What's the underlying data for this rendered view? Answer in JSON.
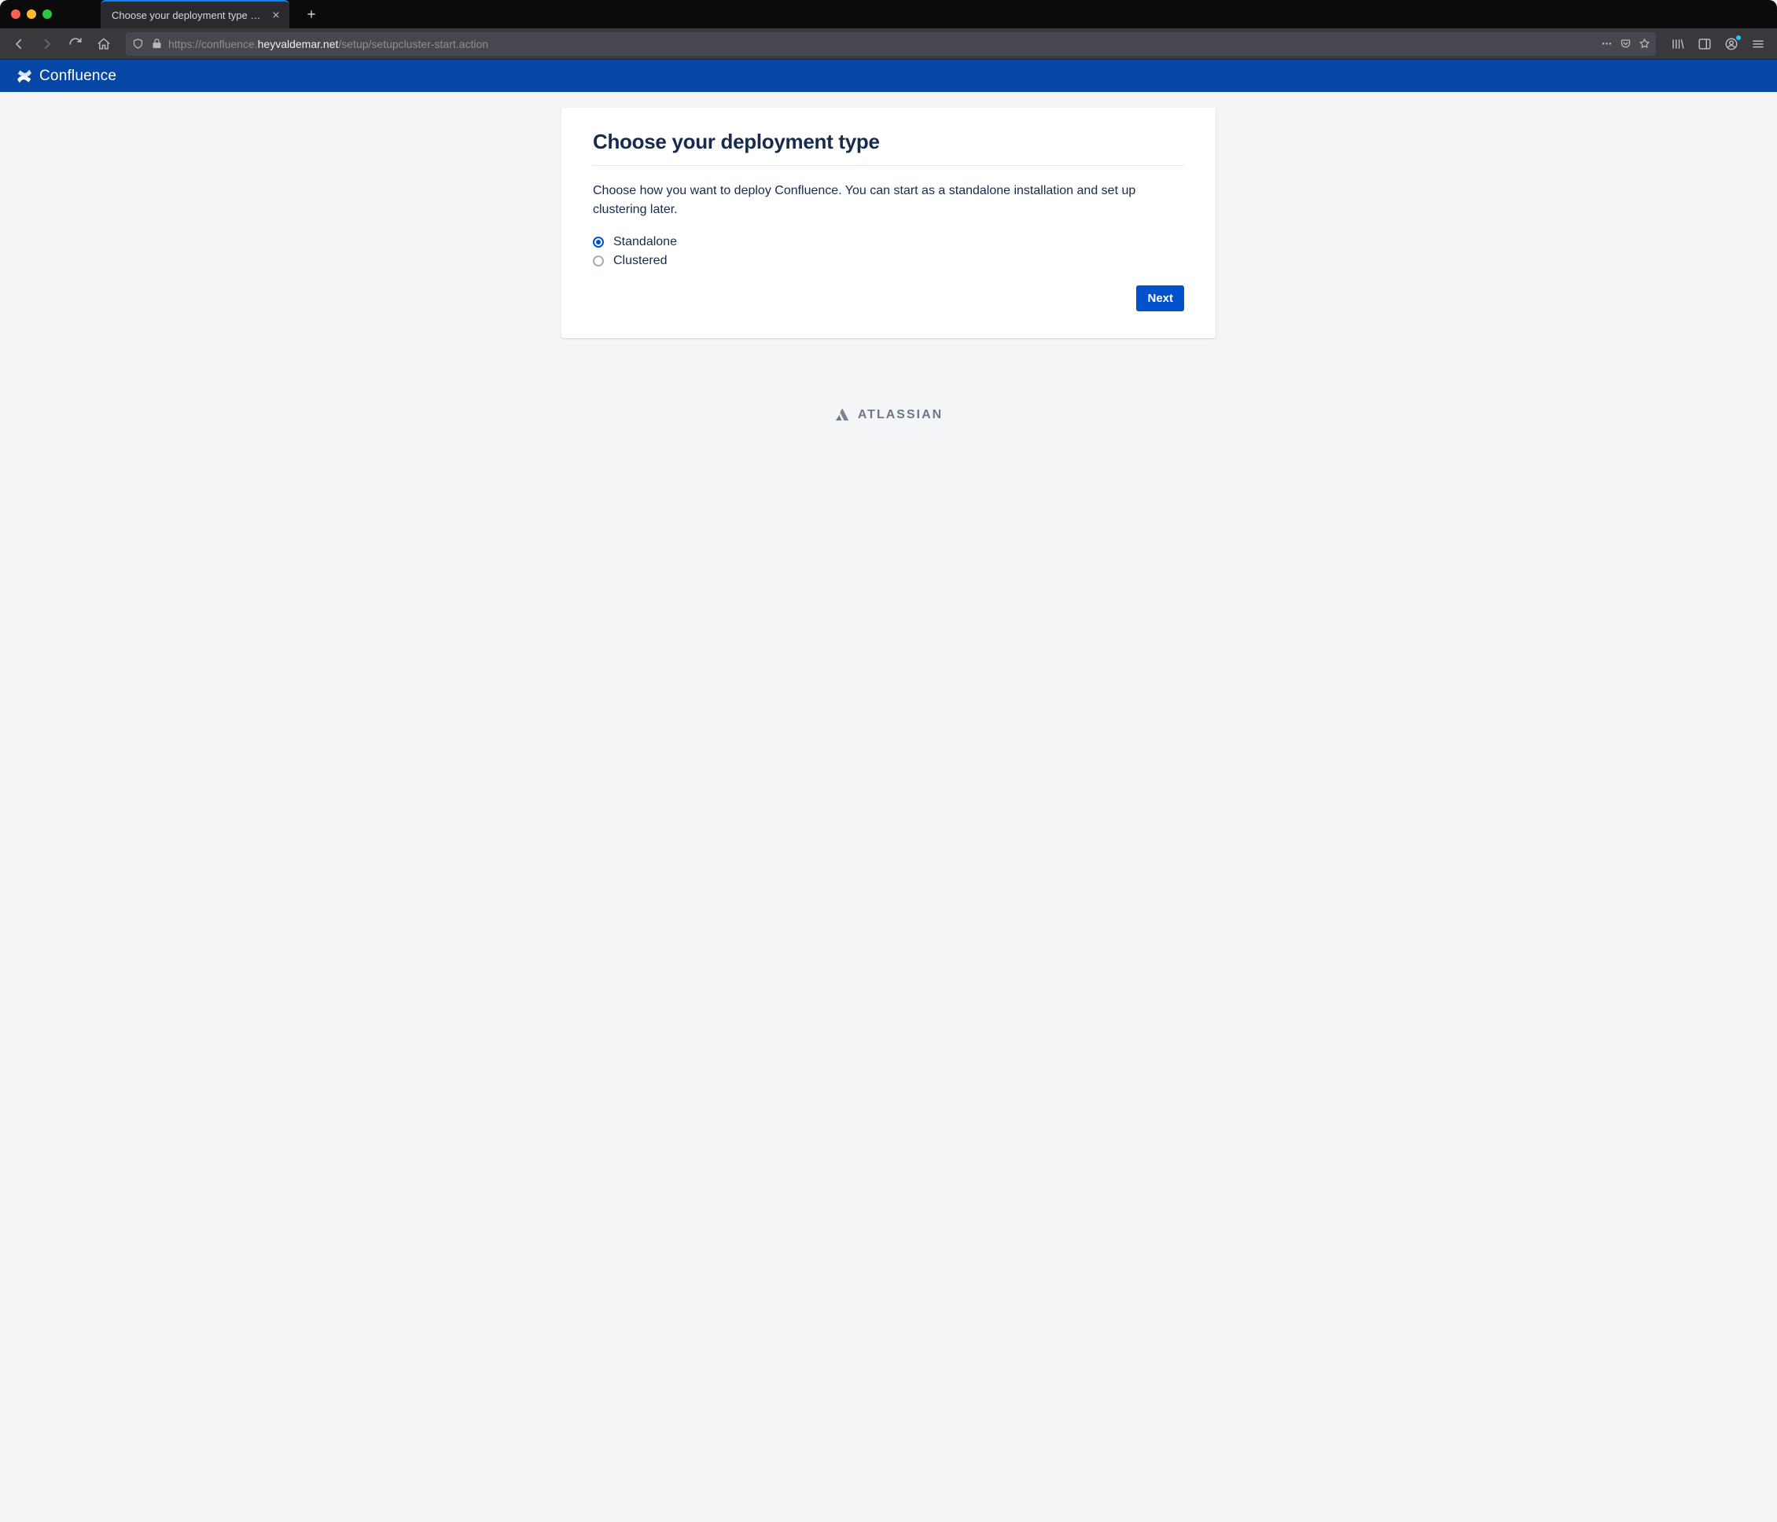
{
  "browser": {
    "tab_title": "Choose your deployment type - Co",
    "url": {
      "scheme_host_prefix": "https://confluence.",
      "host_main": "heyvaldemar.net",
      "path": "/setup/setupcluster-start.action"
    }
  },
  "appbar": {
    "product_name": "Confluence"
  },
  "page": {
    "heading": "Choose your deployment type",
    "description": "Choose how you want to deploy Confluence. You can start as a standalone installation and set up clustering later.",
    "options": {
      "standalone": "Standalone",
      "clustered": "Clustered",
      "selected": "standalone"
    },
    "next_label": "Next"
  },
  "footer": {
    "brand": "ATLASSIAN"
  }
}
